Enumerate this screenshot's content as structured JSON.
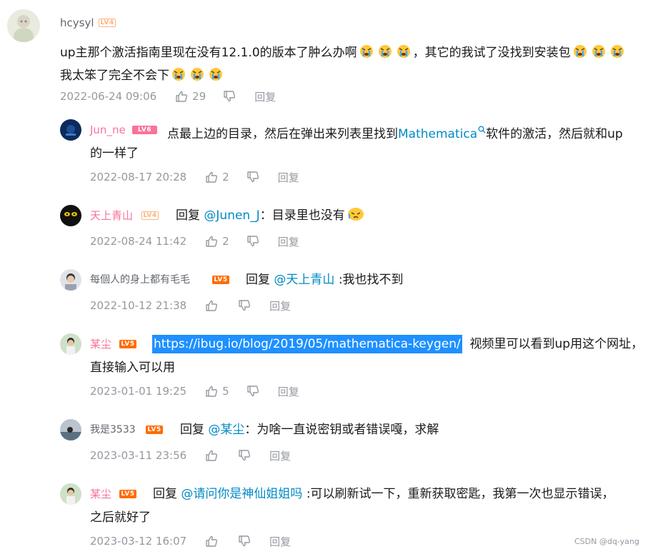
{
  "root": {
    "username": "hcysyl",
    "level": "LV4",
    "content_part1": "up主那个激活指南里现在没有12.1.0的版本了肿么办啊",
    "content_part2": "，其它的我试了没找到安装包",
    "content_part3": "我太笨了完全不会下",
    "time": "2022-06-24 09:06",
    "likes": "29",
    "reply_label": "回复"
  },
  "replies": [
    {
      "username": "Jun_ne",
      "level": "LV6",
      "text_before": "点最上边的目录，然后在弹出来列表里找到",
      "link": "Mathematica",
      "text_after": "软件的激活，然后就和up",
      "text_line2": "的一样了",
      "time": "2022-08-17 20:28",
      "likes": "2",
      "reply_label": "回复"
    },
    {
      "username": "天上青山",
      "level": "LV4",
      "reply_word": "回复",
      "mention": "@Junen_J",
      "text": "：目录里也没有",
      "time": "2022-08-24 11:42",
      "likes": "2",
      "reply_label": "回复"
    },
    {
      "username": "每個人的身上都有毛毛",
      "level": "LV5",
      "reply_word": "回复",
      "mention": "@天上青山",
      "text": ":我也找不到",
      "time": "2022-10-12 21:38",
      "likes": "",
      "reply_label": "回复"
    },
    {
      "username": "某尘",
      "level": "LV5",
      "link": "https://ibug.io/blog/2019/05/mathematica-keygen/",
      "text_after": "视频里可以看到up用这个网址，",
      "text_line2": "直接输入可以用",
      "time": "2023-01-01 19:25",
      "likes": "5",
      "reply_label": "回复"
    },
    {
      "username": "我是3533",
      "level": "LV5",
      "reply_word": "回复",
      "mention": "@某尘",
      "text": "：为啥一直说密钥或者错误嘎，求解",
      "time": "2023-03-11 23:56",
      "likes": "",
      "reply_label": "回复"
    },
    {
      "username": "某尘",
      "level": "LV5",
      "reply_word": "回复",
      "mention": "@请问你是神仙姐姐吗",
      "text": ":可以刷新试一下，重新获取密匙，我第一次也显示错误，",
      "text_line2": "之后就好了",
      "time": "2023-03-12 16:07",
      "likes": "",
      "reply_label": "回复"
    }
  ],
  "watermark": "CSDN @dq-yang",
  "colors": {
    "pink": "#fb7299",
    "link": "#008ac5",
    "meta": "#9499a0",
    "lv5": "#ff6c00",
    "lv4": "#ffb27f",
    "highlight": "#1e90ff"
  }
}
